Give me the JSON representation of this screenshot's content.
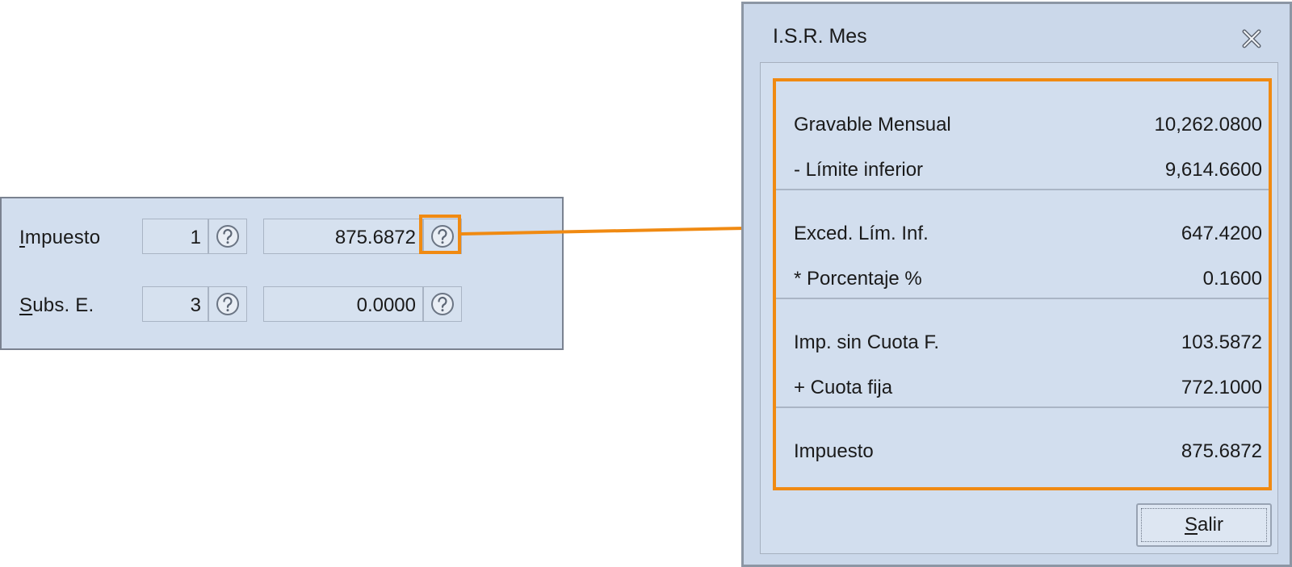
{
  "form": {
    "rows": [
      {
        "label_first": "I",
        "label_rest": "mpuesto",
        "code": "1",
        "amount": "875.6872"
      },
      {
        "label_first": "S",
        "label_rest": "ubs. E.",
        "code": "3",
        "amount": "0.0000"
      }
    ]
  },
  "dialog": {
    "title": "I.S.R. Mes",
    "lines": [
      {
        "label": "Gravable Mensual",
        "value": "10,262.0800"
      },
      {
        "label": "- Límite inferior",
        "value": "9,614.6600"
      },
      {
        "label": "Exced. Lím. Inf.",
        "value": "647.4200"
      },
      {
        "label": "* Porcentaje %",
        "value": "0.1600"
      },
      {
        "label": "Imp. sin Cuota F.",
        "value": "103.5872"
      },
      {
        "label": "+ Cuota fija",
        "value": "772.1000"
      },
      {
        "label": "Impuesto",
        "value": "875.6872"
      }
    ],
    "exit_first": "S",
    "exit_rest": "alir"
  },
  "colors": {
    "highlight": "#f08a12",
    "panel_bg": "#d2deee",
    "dialog_bg": "#cbd8ea"
  },
  "icons": {
    "help": "question-circle-icon",
    "close": "close-x-icon"
  }
}
